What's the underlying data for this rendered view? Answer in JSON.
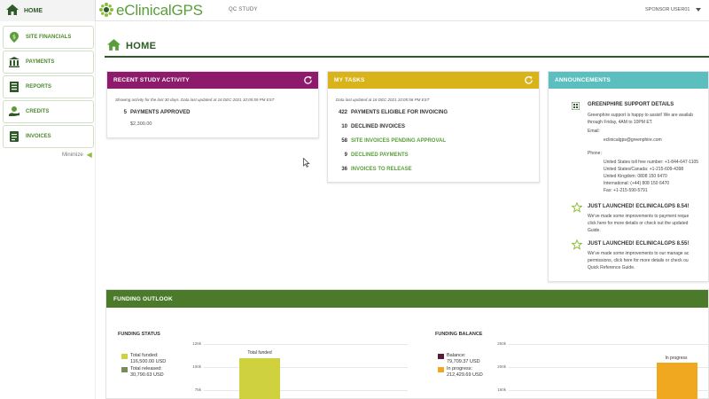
{
  "nav": {
    "home_label": "HOME"
  },
  "app": {
    "logo_text": "eClinicalGPS",
    "study": "QC STUDY",
    "user": "SPONSOR USER01"
  },
  "sidebar": {
    "items": [
      {
        "label": "SITE FINANCIALS",
        "icon": "site-financials-icon"
      },
      {
        "label": "PAYMENTS",
        "icon": "bank-icon"
      },
      {
        "label": "REPORTS",
        "icon": "reports-icon"
      },
      {
        "label": "CREDITS",
        "icon": "credits-hand-icon"
      },
      {
        "label": "INVOICES",
        "icon": "invoice-icon"
      }
    ],
    "minimize_label": "Minimize"
  },
  "page": {
    "title": "HOME"
  },
  "recent_activity": {
    "title": "RECENT STUDY ACTIVITY",
    "note": "Showing activity for the last 30 days. Data last updated at 16 DEC 2021 10:05:59 PM EST",
    "items": [
      {
        "count": "5",
        "label": "PAYMENTS APPROVED",
        "amount": "$2,300.00"
      }
    ],
    "color": "#8d1a6b"
  },
  "my_tasks": {
    "title": "MY TASKS",
    "note": "Data last updated at 16 DEC 2021 10:05:56 PM EST",
    "items": [
      {
        "count": "422",
        "label": "PAYMENTS ELIGIBLE FOR INVOICING"
      },
      {
        "count": "10",
        "label": "DECLINED INVOICES"
      },
      {
        "count": "58",
        "label": "SITE INVOICES PENDING APPROVAL"
      },
      {
        "count": "9",
        "label": "DECLINED PAYMENTS"
      },
      {
        "count": "36",
        "label": "INVOICES TO RELEASE"
      }
    ],
    "color": "#d8b41a"
  },
  "announcements": {
    "title": "ANNOUNCEMENTS",
    "color": "#5bbfbf",
    "support": {
      "title": "GREENPHIRE SUPPORT DETAILS",
      "line1": "Greenphire support is happy to assist! We are availab",
      "line2": "through Friday, 4AM to 10PM ET.",
      "email_label": "Email:",
      "email": "eclinicalgps@greenphire.com",
      "phone_label": "Phone:",
      "phones": [
        "United States toll free number: +1-844-647-1105",
        "United States/Canada: +1-215-609-4398",
        "United Kingdom: 0808 150 6470",
        "International: (+44) 808 150 6470",
        "Fax: +1-215-590-5791"
      ]
    },
    "posts": [
      {
        "title": "JUST LAUNCHED! ECLINICALGPS 8.54!",
        "line1": "We've made some improvements to payment reque",
        "line2": "click here for more details or check out the updated",
        "line3": "Guide."
      },
      {
        "title": "JUST LAUNCHED! ECLINICALGPS 8.55!",
        "line1": "We've made some improvements to our manage ac",
        "line2": "permissions, click here for more details or check ou",
        "line3": "Quick Reference Guide."
      }
    ]
  },
  "funding": {
    "title": "FUNDING OUTLOOK",
    "status": {
      "title": "FUNDING STATUS",
      "legend": [
        {
          "label": "Total funded:",
          "value": "116,500.00 USD",
          "color": "#cfd13e"
        },
        {
          "label": "Total released:",
          "value": "30,790.63 USD",
          "color": "#7a8a5a"
        }
      ],
      "ticks": [
        "125k",
        "100k",
        "75k"
      ],
      "bar_label": "Total funded"
    },
    "balance": {
      "title": "FUNDING BALANCE",
      "legend": [
        {
          "label": "Balance:",
          "value": "79,709.37 USD",
          "color": "#5a1a3a"
        },
        {
          "label": "In progress:",
          "value": "212,429.69 USD",
          "color": "#f0a820"
        }
      ],
      "ticks": [
        "250k",
        "200k",
        "150k"
      ],
      "bar_label": "In progress"
    }
  }
}
